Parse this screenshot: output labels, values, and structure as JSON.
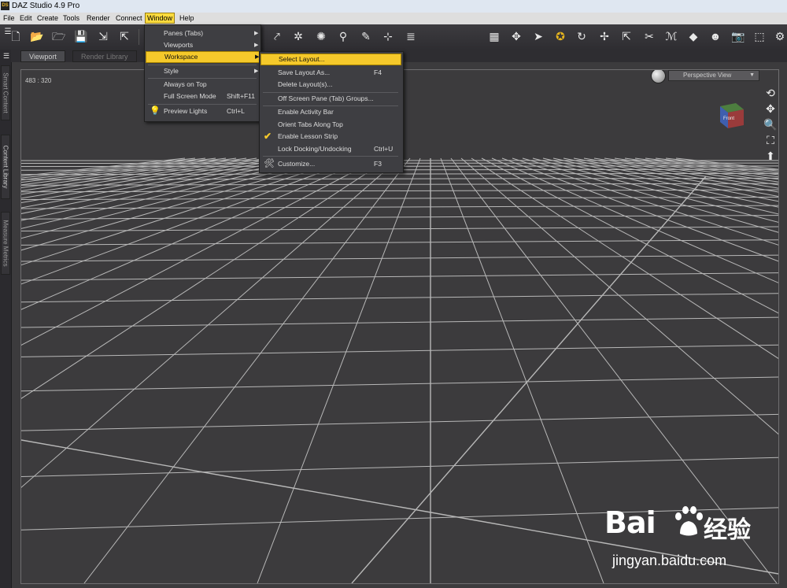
{
  "window": {
    "title": "DAZ Studio 4.9 Pro",
    "logo_text": "DS"
  },
  "menubar": [
    "File",
    "Edit",
    "Create",
    "Tools",
    "Render",
    "Connect",
    "Window",
    "Help"
  ],
  "active_menu": "Window",
  "tabs": {
    "viewport": "Viewport",
    "render_library": "Render Library"
  },
  "side_tabs": [
    "Smart Content",
    "Content Library",
    "Measure Metrics"
  ],
  "viewport": {
    "coords": "483 : 320",
    "view": "Perspective View",
    "cube_label": "Front"
  },
  "window_menu": [
    {
      "label": "Panes (Tabs)",
      "submenu": true
    },
    {
      "label": "Viewports",
      "submenu": true
    },
    {
      "label": "Workspace",
      "submenu": true,
      "highlight": true
    },
    {
      "label": "Style",
      "submenu": true
    },
    {
      "label": "Always on Top"
    },
    {
      "label": "Full Screen Mode",
      "shortcut": "Shift+F11"
    },
    {
      "label": "Preview Lights",
      "shortcut": "Ctrl+L"
    }
  ],
  "workspace_menu": [
    {
      "label": "Select Layout...",
      "highlight": true
    },
    {
      "label": "Save Layout As...",
      "shortcut": "F4"
    },
    {
      "label": "Delete Layout(s)..."
    },
    {
      "label": "Off Screen Pane (Tab) Groups..."
    },
    {
      "label": "Enable Activity Bar"
    },
    {
      "label": "Orient Tabs Along Top"
    },
    {
      "label": "Enable Lesson Strip",
      "checked": true
    },
    {
      "label": "Lock Docking/Undocking",
      "shortcut": "Ctrl+U"
    },
    {
      "label": "Customize...",
      "shortcut": "F3"
    }
  ],
  "watermark": {
    "brand": "Bai",
    "cn": "经验",
    "url": "jingyan.baidu.com"
  },
  "colors": {
    "accent": "#f5c92b",
    "menubar_active": "#fcdb3e",
    "viewport_bg": "#3c3b3d",
    "grid": "#b8b8b8"
  }
}
